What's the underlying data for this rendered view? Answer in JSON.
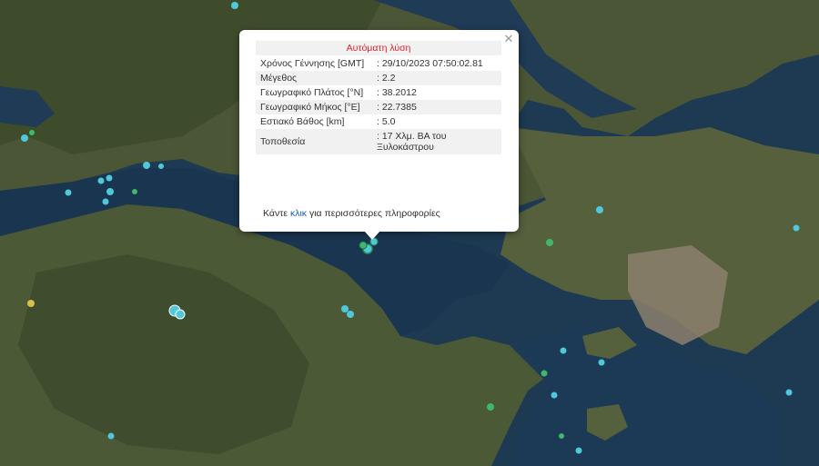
{
  "map": {
    "colors": {
      "sea": "#1d3a52",
      "land": "#4e5a3a",
      "mountain": "#3f4b2e",
      "urban": "#8a7f6e"
    },
    "markers": [
      {
        "color": "#4fc9d8"
      },
      {
        "color": "#4fc9d8"
      },
      {
        "color": "#3fb86a"
      },
      {
        "color": "#d4c34a"
      }
    ]
  },
  "popup": {
    "title": "Αυτόματη λύση",
    "close_icon": "close-icon",
    "rows": [
      {
        "label": "Χρόνος Γέννησης [GMT]",
        "value": ": 29/10/2023 07:50:02.81"
      },
      {
        "label": "Μέγεθος",
        "value": ": 2.2"
      },
      {
        "label": "Γεωγραφικό Πλάτος [°N]",
        "value": ": 38.2012"
      },
      {
        "label": "Γεωγραφικό Μήκος [°E]",
        "value": ": 22.7385"
      },
      {
        "label": "Εστιακό Βάθος [km]",
        "value": ": 5.0"
      },
      {
        "label": "Τοποθεσία",
        "value": ": 17 Χλμ. ΒΑ του Ξυλοκάστρου"
      }
    ],
    "more_prefix": "Κάντε ",
    "more_link": "κλικ",
    "more_suffix": " για περισσότερες πληροφορίες"
  }
}
